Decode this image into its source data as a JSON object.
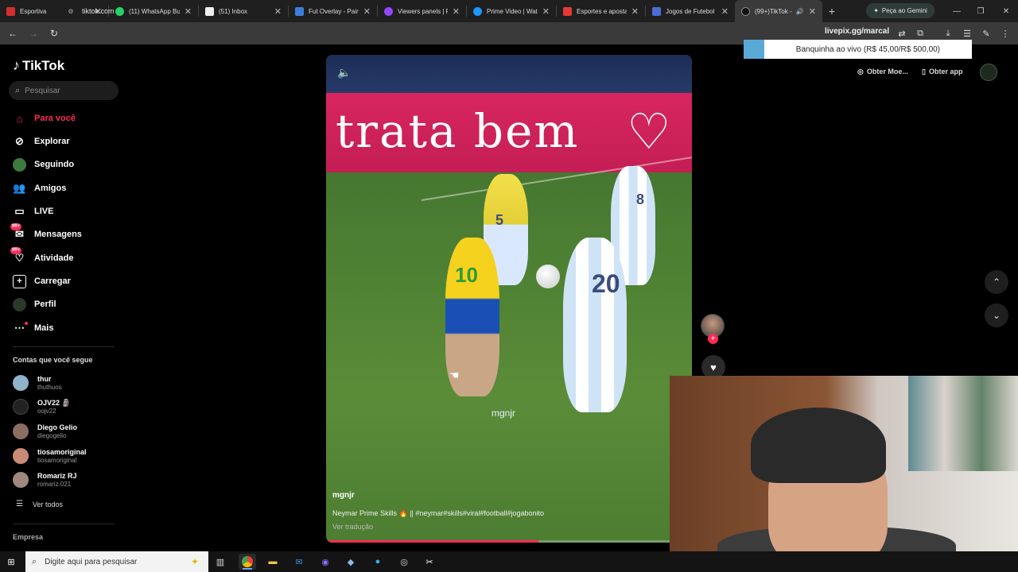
{
  "browser": {
    "tabs": [
      {
        "title": "Esportiva",
        "color": "#d32f2f"
      },
      {
        "title": "(11) WhatsApp Bu",
        "color": "#25d366"
      },
      {
        "title": "(51) Inbox",
        "color": "#eeeeee"
      },
      {
        "title": "Fut Overlay - Pain",
        "color": "#3c7dd9"
      },
      {
        "title": "Viewers panels | R",
        "color": "#9146ff"
      },
      {
        "title": "Prime Video | Wat",
        "color": "#1a98ff"
      },
      {
        "title": "Esportes e aposta",
        "color": "#e53935"
      },
      {
        "title": "Jogos de Futebol",
        "color": "#4a6cd4"
      },
      {
        "title": "(99+)TikTok - ",
        "color": "#111111"
      }
    ],
    "new_tab": "+",
    "gemini_label": "Peça ao Gemini",
    "url": "tiktok.com"
  },
  "overlay": {
    "livepix": "livepix.gg/marcal",
    "banquinha": "Banquinha ao vivo (R$ 45,00/R$ 500,00)",
    "banquinha_progress": 0.09,
    "get_coins": "Obter Moe...",
    "get_app": "Obter app"
  },
  "sidebar": {
    "logo": "TikTok",
    "search_placeholder": "Pesquisar",
    "nav": [
      {
        "label": "Para você",
        "icon": "home-icon"
      },
      {
        "label": "Explorar",
        "icon": "compass-icon"
      },
      {
        "label": "Seguindo",
        "icon": "following-icon"
      },
      {
        "label": "Amigos",
        "icon": "friends-icon"
      },
      {
        "label": "LIVE",
        "icon": "live-icon"
      },
      {
        "label": "Mensagens",
        "icon": "messages-icon",
        "badge": "99+"
      },
      {
        "label": "Atividade",
        "icon": "activity-icon",
        "badge": "99+"
      },
      {
        "label": "Carregar",
        "icon": "upload-icon"
      },
      {
        "label": "Perfil",
        "icon": "profile-icon"
      },
      {
        "label": "Mais",
        "icon": "more-icon"
      }
    ],
    "following_title": "Contas que você segue",
    "accounts": [
      {
        "name": "thur",
        "handle": "thuthuos",
        "color": "#8fb3c9"
      },
      {
        "name": "OJV22 🗿",
        "handle": "oojv22",
        "color": "#222222"
      },
      {
        "name": "Diego Gelio",
        "handle": "diegogelio",
        "color": "#8d6e63"
      },
      {
        "name": "tiosamoriginal",
        "handle": "tiosamoriginal",
        "color": "#c98a76"
      },
      {
        "name": "Romariz RJ",
        "handle": "romariz.021",
        "color": "#a1887f"
      }
    ],
    "see_all": "Ver todos",
    "company": "Empresa"
  },
  "video": {
    "board_text": "trata bem",
    "watermark": "mgnjr",
    "author": "mgnjr",
    "caption": "Neymar Prime Skills 🔥 || #neymar#skills#viral#football#jogabonito",
    "see_translation": "Ver tradução",
    "progress": 0.58,
    "jerseys": [
      "10",
      "5",
      "8",
      "20"
    ]
  },
  "taskbar": {
    "search_placeholder": "Digite aqui para pesquisar"
  },
  "colors": {
    "accent": "#fe2c55",
    "chrome_bg": "#1f1f1f",
    "toolbar_bg": "#3a3a3a"
  }
}
